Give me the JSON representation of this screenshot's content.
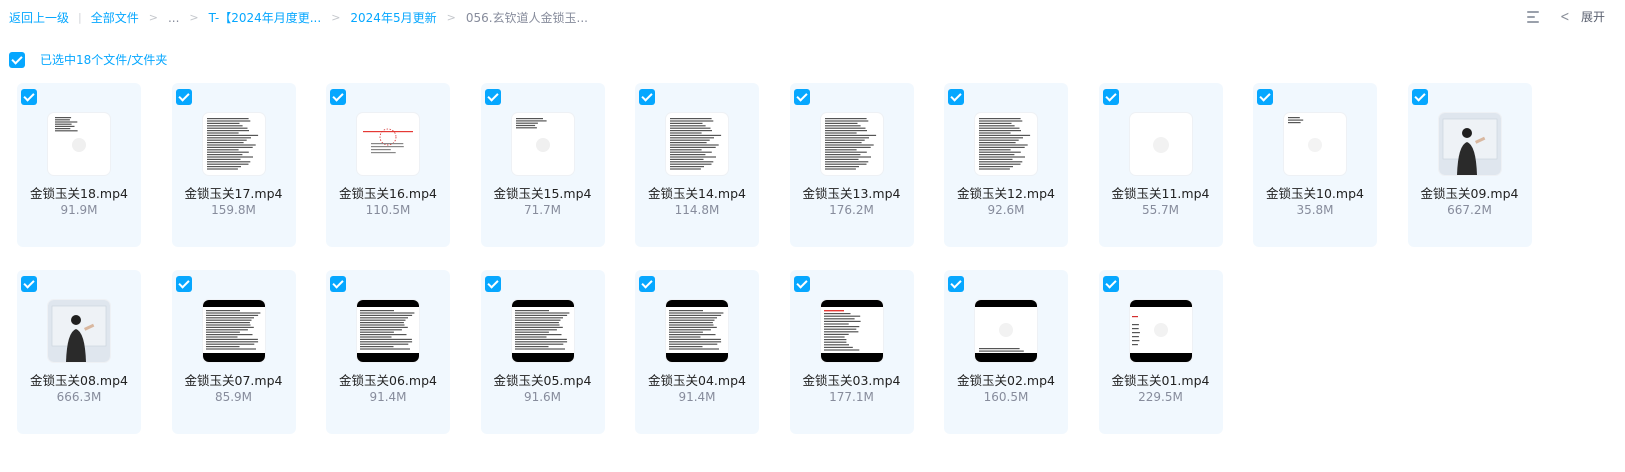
{
  "breadcrumb": {
    "back": "返回上一级",
    "all_files": "全部文件",
    "ellipsis": "...",
    "folder1": "T-【2024年月度更...",
    "folder2": "2024年5月更新",
    "current": "056.玄钦道人金锁玉..."
  },
  "toolbar": {
    "expand_label": "展开"
  },
  "selection": {
    "text": "已选中18个文件/文件夹"
  },
  "files": [
    {
      "name": "金锁玉关18.mp4",
      "size": "91.9M",
      "thumb": "doc-sparse"
    },
    {
      "name": "金锁玉关17.mp4",
      "size": "159.8M",
      "thumb": "doc-dense"
    },
    {
      "name": "金锁玉关16.mp4",
      "size": "110.5M",
      "thumb": "diagram-red"
    },
    {
      "name": "金锁玉关15.mp4",
      "size": "71.7M",
      "thumb": "doc-top"
    },
    {
      "name": "金锁玉关14.mp4",
      "size": "114.8M",
      "thumb": "doc-dense"
    },
    {
      "name": "金锁玉关13.mp4",
      "size": "176.2M",
      "thumb": "doc-dense"
    },
    {
      "name": "金锁玉关12.mp4",
      "size": "92.6M",
      "thumb": "doc-dense"
    },
    {
      "name": "金锁玉关11.mp4",
      "size": "55.7M",
      "thumb": "blank"
    },
    {
      "name": "金锁玉关10.mp4",
      "size": "35.8M",
      "thumb": "doc-lines"
    },
    {
      "name": "金锁玉关09.mp4",
      "size": "667.2M",
      "thumb": "person"
    },
    {
      "name": "金锁玉关08.mp4",
      "size": "666.3M",
      "thumb": "person"
    },
    {
      "name": "金锁玉关07.mp4",
      "size": "85.9M",
      "thumb": "letterbox"
    },
    {
      "name": "金锁玉关06.mp4",
      "size": "91.4M",
      "thumb": "letterbox"
    },
    {
      "name": "金锁玉关05.mp4",
      "size": "91.6M",
      "thumb": "letterbox"
    },
    {
      "name": "金锁玉关04.mp4",
      "size": "91.4M",
      "thumb": "letterbox"
    },
    {
      "name": "金锁玉关03.mp4",
      "size": "177.1M",
      "thumb": "letterbox-red"
    },
    {
      "name": "金锁玉关02.mp4",
      "size": "160.5M",
      "thumb": "letterbox-blank"
    },
    {
      "name": "金锁玉关01.mp4",
      "size": "229.5M",
      "thumb": "letterbox-side"
    }
  ],
  "colors": {
    "accent": "#06a7ff",
    "tile_bg": "#f1f8fe"
  }
}
